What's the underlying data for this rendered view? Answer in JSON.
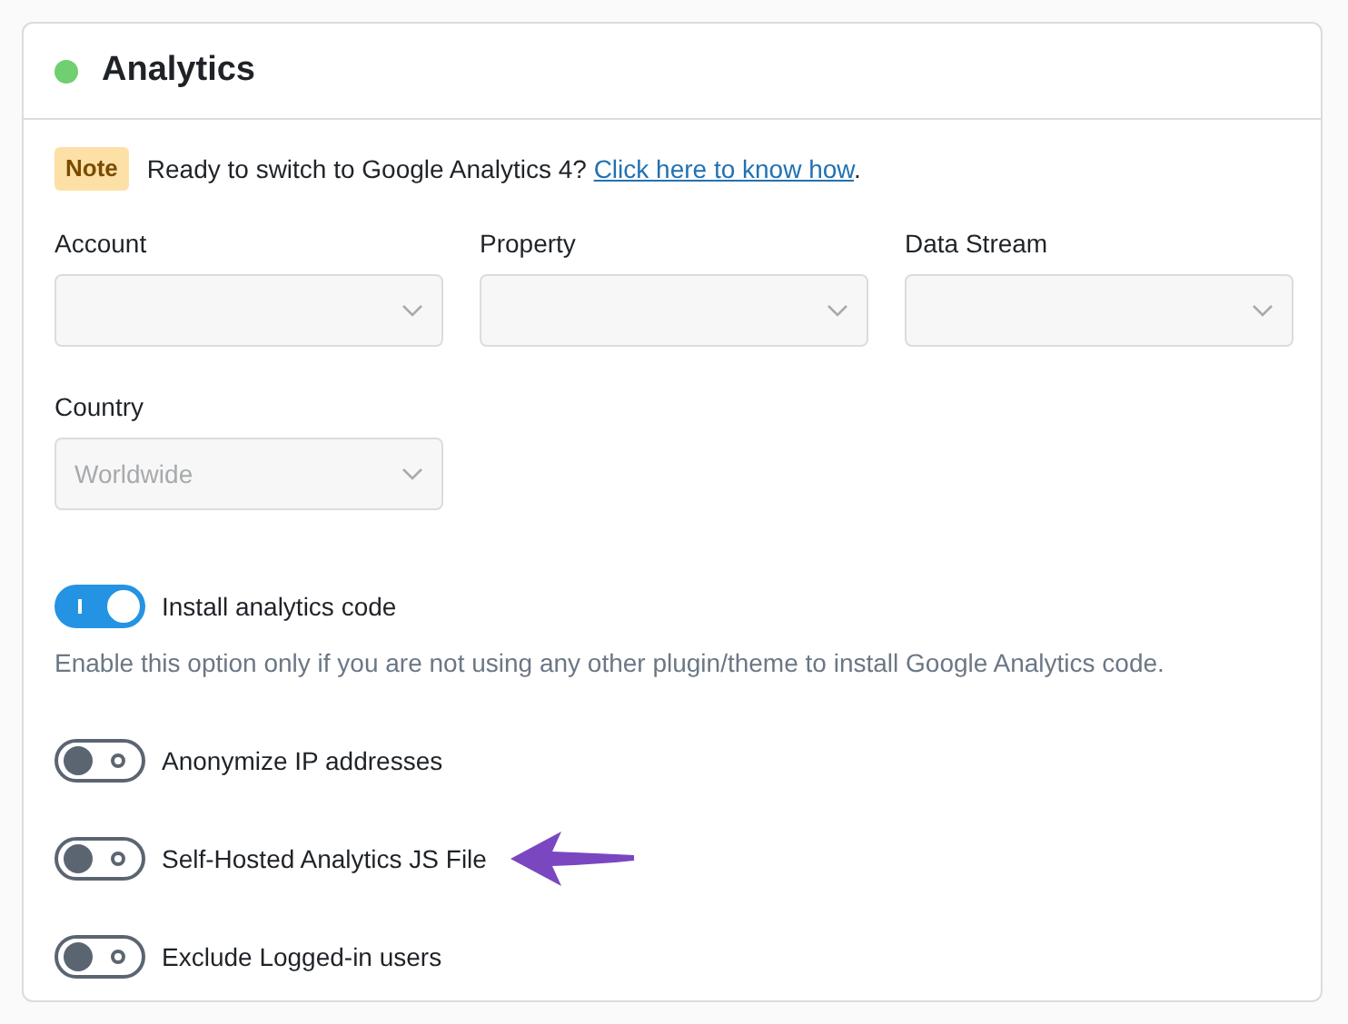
{
  "panel": {
    "title": "Analytics",
    "active": true
  },
  "note": {
    "badge": "Note",
    "text": "Ready to switch to Google Analytics 4?",
    "link": "Click here to know how",
    "after": "."
  },
  "fields": [
    {
      "label": "Account",
      "disabled": true
    },
    {
      "label": "Property",
      "disabled": true
    },
    {
      "label": "Data Stream",
      "disabled": true
    },
    {
      "label": "Country",
      "value": "Worldwide",
      "disabled": true
    }
  ],
  "toggles": [
    {
      "label": "Install analytics code",
      "on": true,
      "description": "Enable this option only if you are not using any other plugin/theme to install Google Analytics code."
    },
    {
      "label": "Anonymize IP addresses",
      "on": false
    },
    {
      "label": "Self-Hosted Analytics JS File",
      "on": false,
      "pointer": true
    },
    {
      "label": "Exclude Logged-in users",
      "on": false
    }
  ]
}
